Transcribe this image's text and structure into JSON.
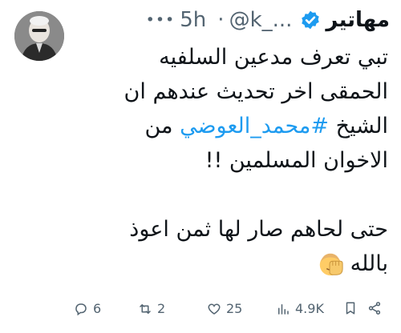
{
  "tweet": {
    "author": {
      "display_name": "مهاتير",
      "handle": "@k_...",
      "verified": true
    },
    "timestamp": "5h",
    "lines": [
      "تبي تعرف مدعين السلفيه",
      "الحمقى اخر تحديث عندهم ان",
      "الشيخ",
      "من",
      "الاخوان المسلمين !!",
      "حتى لحاهم صار لها ثمن اعوذ",
      "بالله"
    ],
    "hashtag": "#محمد_العوضي",
    "emoji": "face-palm-emoji"
  },
  "actions": {
    "replies": "6",
    "retweets": "2",
    "likes": "25",
    "views": "4.9K"
  },
  "colors": {
    "accent": "#1d9bf0",
    "muted": "#536471",
    "text": "#0f1419"
  }
}
